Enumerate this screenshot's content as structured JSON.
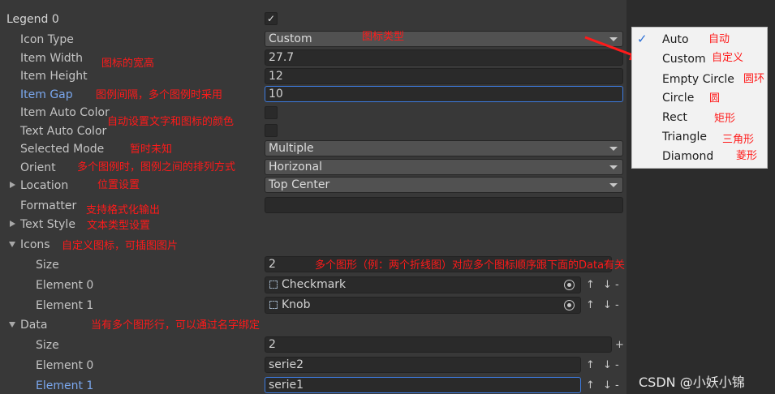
{
  "legend": {
    "title": "Legend 0",
    "enabled_mark": "✓"
  },
  "labels": {
    "icon_type": "Icon Type",
    "item_width": "Item Width",
    "item_height": "Item Height",
    "item_gap": "Item Gap",
    "item_auto_color": "Item Auto Color",
    "text_auto_color": "Text Auto Color",
    "selected_mode": "Selected Mode",
    "orient": "Orient",
    "location": "Location",
    "formatter": "Formatter",
    "text_style": "Text Style",
    "icons": "Icons",
    "icons_size": "Size",
    "icons_el0": "Element 0",
    "icons_el1": "Element 1",
    "data": "Data",
    "data_size": "Size",
    "data_el0": "Element 0",
    "data_el1": "Element 1"
  },
  "values": {
    "icon_type": "Custom",
    "item_width": "27.7",
    "item_height": "12",
    "item_gap": "10",
    "selected_mode": "Multiple",
    "orient": "Horizonal",
    "location": "Top Center",
    "formatter": "",
    "icons_size": "2",
    "icons_el0": "Checkmark",
    "icons_el1": "Knob",
    "data_size": "2",
    "data_el0": "serie2",
    "data_el1": "serie1"
  },
  "controls": {
    "up_down": "↑ ↓",
    "minus": "-",
    "plus": "+"
  },
  "annotations": {
    "icon_type": "图标类型",
    "item_width": "图标的宽高",
    "item_gap": "图例间隔，多个图例时采用",
    "auto_color": "自动设置文字和图标的颜色",
    "selected_mode": "暂时未知",
    "orient": "多个图例时，图例之间的排列方式",
    "location": "位置设置",
    "formatter": "支持格式化输出",
    "text_style": "文本类型设置",
    "icons": "自定义图标，可插图图片",
    "icons_size": "多个图形（例：两个折线图）对应多个图标顺序跟下面的Data有关",
    "data": "当有多个图形行，可以通过名字绑定"
  },
  "popup": {
    "items": [
      {
        "label": "Auto",
        "cn": "自动",
        "checked": true
      },
      {
        "label": "Custom",
        "cn": "自定义",
        "checked": false
      },
      {
        "label": "Empty Circle",
        "cn": "圆环",
        "checked": false
      },
      {
        "label": "Circle",
        "cn": "圆",
        "checked": false
      },
      {
        "label": "Rect",
        "cn": "矩形",
        "checked": false
      },
      {
        "label": "Triangle",
        "cn": "三角形",
        "checked": false
      },
      {
        "label": "Diamond",
        "cn": "菱形",
        "checked": false
      }
    ]
  },
  "watermark": "CSDN @小妖小锦",
  "colors": {
    "annotation": "#ff1a1a",
    "accent": "#3d7be0",
    "panel": "#383838",
    "popup": "#f2f2f2"
  }
}
